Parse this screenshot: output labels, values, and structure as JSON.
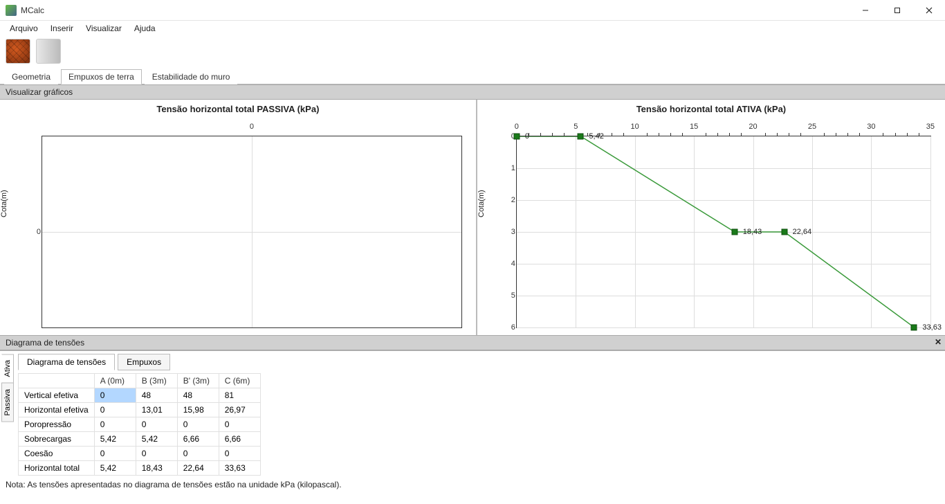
{
  "app": {
    "title": "MCalc"
  },
  "menu": {
    "arquivo": "Arquivo",
    "inserir": "Inserir",
    "visualizar": "Visualizar",
    "ajuda": "Ajuda"
  },
  "view_tabs": {
    "geometria": "Geometria",
    "empuxos": "Empuxos de terra",
    "estabilidade": "Estabilidade do muro"
  },
  "sections": {
    "visualizar_graficos": "Visualizar gráficos",
    "diagrama_tensoes": "Diagrama de tensões"
  },
  "charts": {
    "passiva": {
      "title": "Tensão horizontal total PASSIVA (kPa)",
      "ylabel": "Cota(m)",
      "x_tick0": "0",
      "y_tick0": "0"
    },
    "ativa": {
      "title": "Tensão horizontal total ATIVA (kPa)",
      "ylabel": "Cota(m)"
    }
  },
  "chart_data": [
    {
      "name": "passiva",
      "type": "line",
      "title": "Tensão horizontal total PASSIVA (kPa)",
      "xlabel": "",
      "ylabel": "Cota(m)",
      "x": [
        0
      ],
      "y": [
        0
      ],
      "xlim": [
        0,
        0
      ],
      "ylim_inverted": true
    },
    {
      "name": "ativa",
      "type": "line",
      "title": "Tensão horizontal total ATIVA (kPa)",
      "xlabel": "",
      "ylabel": "Cota(m)",
      "series": [
        {
          "name": "Horizontal total",
          "points": [
            {
              "x": 0,
              "y": 0,
              "label": "0"
            },
            {
              "x": 5.42,
              "y": 0,
              "label": "5,42"
            },
            {
              "x": 18.43,
              "y": 3,
              "label": "18,43"
            },
            {
              "x": 22.64,
              "y": 3,
              "label": "22,64"
            },
            {
              "x": 33.63,
              "y": 6,
              "label": "33,63"
            }
          ]
        }
      ],
      "x_ticks": [
        0,
        5,
        10,
        15,
        20,
        25,
        30,
        35
      ],
      "y_ticks": [
        0,
        1,
        2,
        3,
        4,
        5,
        6
      ],
      "xlim": [
        0,
        35
      ],
      "ylim": [
        0,
        6
      ],
      "ylim_inverted": true
    }
  ],
  "side_tabs": {
    "ativa": "Ativa",
    "passiva": "Passiva"
  },
  "inner_tabs": {
    "diagrama": "Diagrama de tensões",
    "empuxos": "Empuxos"
  },
  "table": {
    "headers": [
      "",
      "A (0m)",
      "B (3m)",
      "B' (3m)",
      "C (6m)"
    ],
    "rows": [
      {
        "label": "Vertical efetiva",
        "cells": [
          "0",
          "48",
          "48",
          "81"
        ]
      },
      {
        "label": "Horizontal efetiva",
        "cells": [
          "0",
          "13,01",
          "15,98",
          "26,97"
        ]
      },
      {
        "label": "Poropressão",
        "cells": [
          "0",
          "0",
          "0",
          "0"
        ]
      },
      {
        "label": "Sobrecargas",
        "cells": [
          "5,42",
          "5,42",
          "6,66",
          "6,66"
        ]
      },
      {
        "label": "Coesão",
        "cells": [
          "0",
          "0",
          "0",
          "0"
        ]
      },
      {
        "label": "Horizontal total",
        "cells": [
          "5,42",
          "18,43",
          "22,64",
          "33,63"
        ]
      }
    ],
    "selected": {
      "row": 0,
      "col": 0
    }
  },
  "footnote": "Nota: As tensões apresentadas no diagrama de tensões estão na unidade kPa (kilopascal)."
}
